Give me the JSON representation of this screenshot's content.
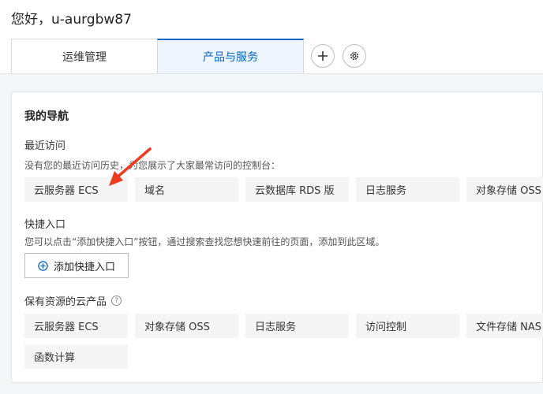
{
  "header": {
    "greeting": "您好，u-aurgbw87",
    "tabs": [
      {
        "label": "运维管理"
      },
      {
        "label": "产品与服务"
      }
    ]
  },
  "nav": {
    "title": "我的导航",
    "recent": {
      "heading": "最近访问",
      "note": "没有您的最近访问历史，为您展示了大家最常访问的控制台：",
      "items": [
        "云服务器 ECS",
        "域名",
        "云数据库 RDS 版",
        "日志服务",
        "对象存储 OSS"
      ]
    },
    "shortcuts": {
      "heading": "快捷入口",
      "note": "您可以点击“添加快捷入口”按钮，通过搜索查找您想快速前往的页面，添加到此区域。",
      "add_label": "添加快捷入口"
    },
    "owned": {
      "heading": "保有资源的云产品",
      "help": "?",
      "items": [
        "云服务器 ECS",
        "对象存储 OSS",
        "日志服务",
        "访问控制",
        "文件存储 NAS",
        "函数计算"
      ]
    }
  },
  "colors": {
    "accent": "#0064c8",
    "annotation_arrow": "#ee3a1e"
  },
  "icons": {
    "add": "plus-icon",
    "settings": "gear-icon",
    "help": "question-icon"
  }
}
